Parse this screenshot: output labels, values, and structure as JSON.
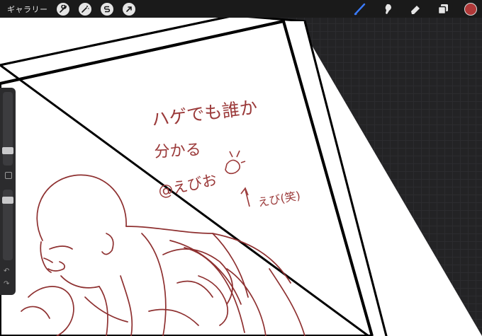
{
  "topbar": {
    "gallery_label": "ギャラリー",
    "left_tools": [
      {
        "name": "actions",
        "icon": "wrench-icon"
      },
      {
        "name": "adjustments",
        "icon": "magic-wand-icon"
      },
      {
        "name": "selection",
        "icon": "selection-s-icon"
      },
      {
        "name": "transform",
        "icon": "arrow-cursor-icon"
      }
    ],
    "right_tools": [
      {
        "name": "brush",
        "icon": "brush-icon",
        "active": true,
        "color": "#3a7bff"
      },
      {
        "name": "smudge",
        "icon": "smudge-icon"
      },
      {
        "name": "eraser",
        "icon": "eraser-icon"
      },
      {
        "name": "layers",
        "icon": "layers-icon"
      }
    ],
    "current_color": "#b03838"
  },
  "sidebar": {
    "size_slider_level": 0.35,
    "opacity_slider_level": 0.85,
    "undo_icon": "undo-icon",
    "redo_icon": "redo-icon"
  },
  "canvas": {
    "handwritten_lines": [
      "ハゲでも誰か",
      "分かる",
      "@えびお",
      "えび(笑)"
    ],
    "ink_color": "#9b3a3a"
  }
}
